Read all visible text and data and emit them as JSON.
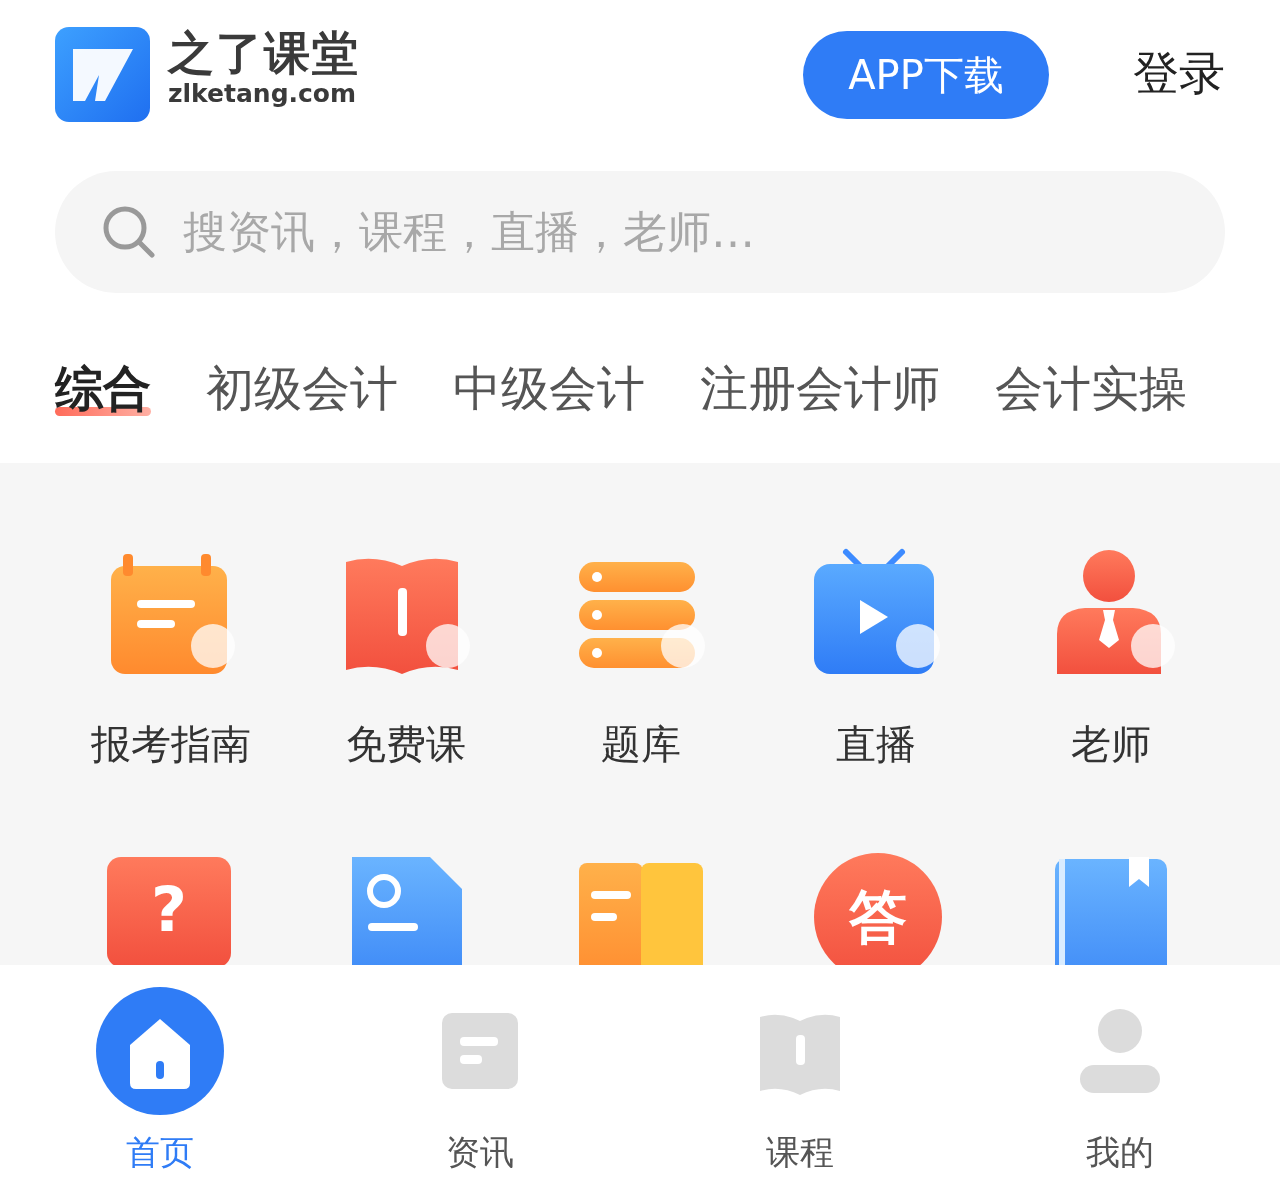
{
  "logo": {
    "name": "之了课堂",
    "domain": "zlketang.com"
  },
  "download_button": "APP下载",
  "login_link": "登录",
  "search": {
    "placeholder": "搜资讯，课程，直播，老师…"
  },
  "category_tabs": [
    {
      "label": "综合",
      "selected": true
    },
    {
      "label": "初级会计",
      "selected": false
    },
    {
      "label": "中级会计",
      "selected": false
    },
    {
      "label": "注册会计师",
      "selected": false
    },
    {
      "label": "会计实操",
      "selected": false
    }
  ],
  "shortcuts": [
    {
      "kind": "calendar",
      "label": "报考指南"
    },
    {
      "kind": "book",
      "label": "免费课"
    },
    {
      "kind": "stack",
      "label": "题库"
    },
    {
      "kind": "tv",
      "label": "直播"
    },
    {
      "kind": "person",
      "label": "老师"
    }
  ],
  "shortcuts_row_2": [
    {
      "kind": "question",
      "glyph": "?"
    },
    {
      "kind": "document"
    },
    {
      "kind": "books"
    },
    {
      "kind": "answer",
      "glyph": "答"
    },
    {
      "kind": "notebook"
    }
  ],
  "bottom_nav": [
    {
      "kind": "home",
      "label": "首页",
      "selected": true
    },
    {
      "kind": "news",
      "label": "资讯",
      "selected": false
    },
    {
      "kind": "course",
      "label": "课程",
      "selected": false
    },
    {
      "kind": "user",
      "label": "我的",
      "selected": false
    }
  ]
}
